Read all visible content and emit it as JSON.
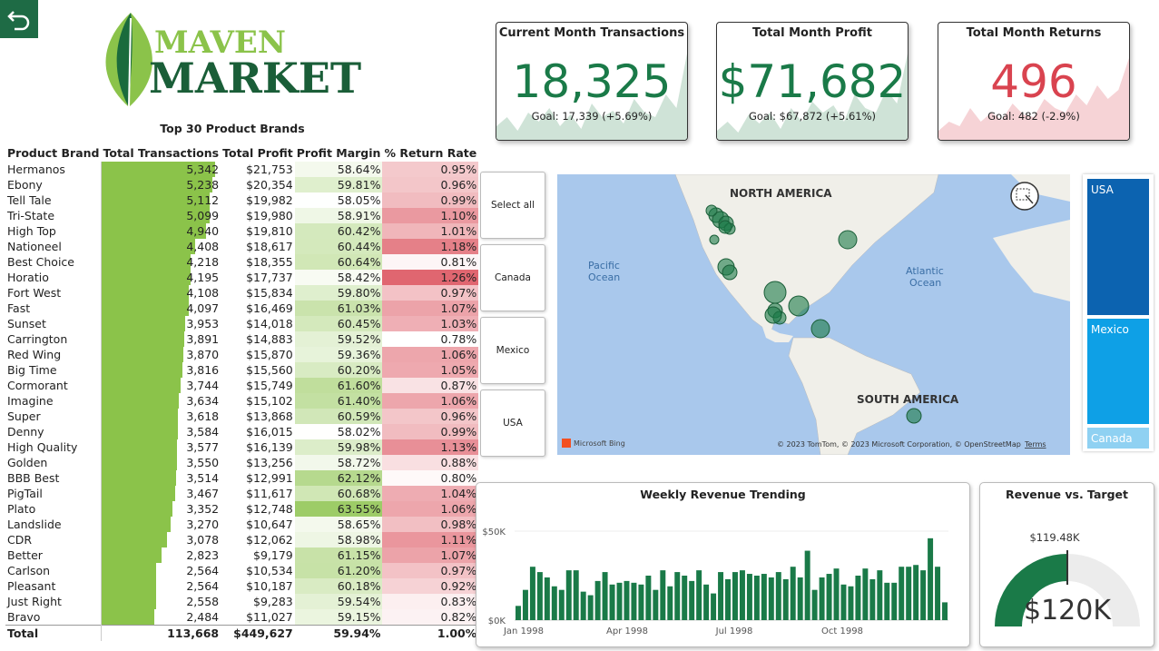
{
  "nav": {
    "back_icon": "back-arrow-icon"
  },
  "logo": {
    "line1": "MAVEN",
    "line2": "MARKET"
  },
  "table": {
    "title": "Top 30 Product Brands",
    "headers": [
      "Product Brand",
      "Total Transactions",
      "Total Profit",
      "Profit Margin",
      "% Return Rate"
    ],
    "rows": [
      [
        "Hermanos",
        "5,342",
        "$21,753",
        "58.64%",
        "0.95%"
      ],
      [
        "Ebony",
        "5,238",
        "$20,354",
        "59.81%",
        "0.96%"
      ],
      [
        "Tell Tale",
        "5,112",
        "$19,982",
        "58.05%",
        "0.99%"
      ],
      [
        "Tri-State",
        "5,099",
        "$19,980",
        "58.91%",
        "1.10%"
      ],
      [
        "High Top",
        "4,940",
        "$19,810",
        "60.42%",
        "1.01%"
      ],
      [
        "Nationeel",
        "4,408",
        "$18,617",
        "60.44%",
        "1.18%"
      ],
      [
        "Best Choice",
        "4,218",
        "$18,355",
        "60.64%",
        "0.81%"
      ],
      [
        "Horatio",
        "4,195",
        "$17,737",
        "58.42%",
        "1.26%"
      ],
      [
        "Fort West",
        "4,108",
        "$15,834",
        "59.80%",
        "0.97%"
      ],
      [
        "Fast",
        "4,097",
        "$16,469",
        "61.03%",
        "1.07%"
      ],
      [
        "Sunset",
        "3,953",
        "$14,018",
        "60.45%",
        "1.03%"
      ],
      [
        "Carrington",
        "3,891",
        "$14,883",
        "59.52%",
        "0.78%"
      ],
      [
        "Red Wing",
        "3,870",
        "$15,870",
        "59.36%",
        "1.06%"
      ],
      [
        "Big Time",
        "3,816",
        "$15,560",
        "60.20%",
        "1.05%"
      ],
      [
        "Cormorant",
        "3,744",
        "$15,749",
        "61.60%",
        "0.87%"
      ],
      [
        "Imagine",
        "3,634",
        "$15,102",
        "61.40%",
        "1.06%"
      ],
      [
        "Super",
        "3,618",
        "$13,868",
        "60.59%",
        "0.96%"
      ],
      [
        "Denny",
        "3,584",
        "$16,015",
        "58.02%",
        "0.99%"
      ],
      [
        "High Quality",
        "3,577",
        "$16,139",
        "59.98%",
        "1.13%"
      ],
      [
        "Golden",
        "3,550",
        "$13,256",
        "58.72%",
        "0.88%"
      ],
      [
        "BBB Best",
        "3,514",
        "$12,991",
        "62.12%",
        "0.80%"
      ],
      [
        "PigTail",
        "3,467",
        "$11,617",
        "60.68%",
        "1.04%"
      ],
      [
        "Plato",
        "3,352",
        "$12,748",
        "63.55%",
        "1.06%"
      ],
      [
        "Landslide",
        "3,270",
        "$10,647",
        "58.65%",
        "0.98%"
      ],
      [
        "CDR",
        "3,078",
        "$12,062",
        "58.98%",
        "1.11%"
      ],
      [
        "Better",
        "2,823",
        "$9,179",
        "61.15%",
        "1.07%"
      ],
      [
        "Carlson",
        "2,564",
        "$10,534",
        "61.20%",
        "0.97%"
      ],
      [
        "Pleasant",
        "2,564",
        "$10,187",
        "60.18%",
        "0.92%"
      ],
      [
        "Just Right",
        "2,558",
        "$9,283",
        "59.54%",
        "0.83%"
      ],
      [
        "Bravo",
        "2,484",
        "$11,027",
        "59.15%",
        "0.82%"
      ]
    ],
    "total": [
      "Total",
      "113,668",
      "$449,627",
      "59.94%",
      "1.00%"
    ],
    "sort_icon": "sort-descending-icon"
  },
  "kpis": [
    {
      "title": "Current Month Transactions",
      "value": "18,325",
      "goal": "Goal: 17,339 (+5.69%)",
      "color": "#1a7a48",
      "fill": "#cfe3d7"
    },
    {
      "title": "Total Month Profit",
      "value": "$71,682",
      "goal": "Goal: $67,872 (+5.61%)",
      "color": "#1a7a48",
      "fill": "#cfe3d7"
    },
    {
      "title": "Total Month Returns",
      "value": "496",
      "goal": "Goal: 482 (-2.9%)",
      "color": "#d9434f",
      "fill": "#f6d3d6"
    }
  ],
  "slicers": [
    "Select all",
    "Canada",
    "Mexico",
    "USA"
  ],
  "map": {
    "labels": {
      "north_america": "NORTH AMERICA",
      "south_america": "SOUTH AMERICA",
      "pacific": "Pacific",
      "pacific2": "Ocean",
      "atlantic": "Atlantic",
      "atlantic2": "Ocean"
    },
    "bing": "Microsoft Bing",
    "copyright": "© 2023 TomTom, © 2023 Microsoft Corporation, © OpenStreetMap",
    "terms": "Terms",
    "select_icon": "lasso-select-icon"
  },
  "treemap": {
    "items": [
      {
        "label": "USA",
        "color": "#0c63b0"
      },
      {
        "label": "Mexico",
        "color": "#0ea0e6"
      },
      {
        "label": "Canada",
        "color": "#8fd1f2"
      }
    ]
  },
  "weekly": {
    "title": "Weekly Revenue Trending",
    "y_ticks": [
      "$50K",
      "$0K"
    ],
    "x_ticks": [
      "Jan 1998",
      "Apr 1998",
      "Jul 1998",
      "Oct 1998"
    ]
  },
  "gauge": {
    "title": "Revenue vs. Target",
    "value": "$120K",
    "target": "$119.48K"
  },
  "colors": {
    "green": "#1a7a48",
    "brand_green": "#8bc34a",
    "red": "#e06670"
  },
  "chart_data": {
    "type": "bar",
    "title": "Weekly Revenue Trending",
    "ylim": [
      0,
      55000
    ],
    "x_labels": [
      "Jan 1998",
      "Apr 1998",
      "Jul 1998",
      "Oct 1998"
    ],
    "values": [
      8000,
      17000,
      30000,
      27000,
      24000,
      19000,
      17000,
      28000,
      28000,
      16000,
      14000,
      22000,
      27000,
      20000,
      21000,
      22000,
      21000,
      20000,
      25000,
      17000,
      28000,
      19000,
      27000,
      25000,
      22000,
      28000,
      20000,
      15000,
      27000,
      23000,
      27000,
      28000,
      26000,
      25000,
      26000,
      24000,
      27000,
      23000,
      30000,
      24000,
      39000,
      17000,
      24000,
      26000,
      29000,
      20000,
      19000,
      25000,
      29000,
      23000,
      28000,
      21000,
      21000,
      30000,
      30000,
      31000,
      28000,
      46000,
      30000,
      10000
    ]
  }
}
